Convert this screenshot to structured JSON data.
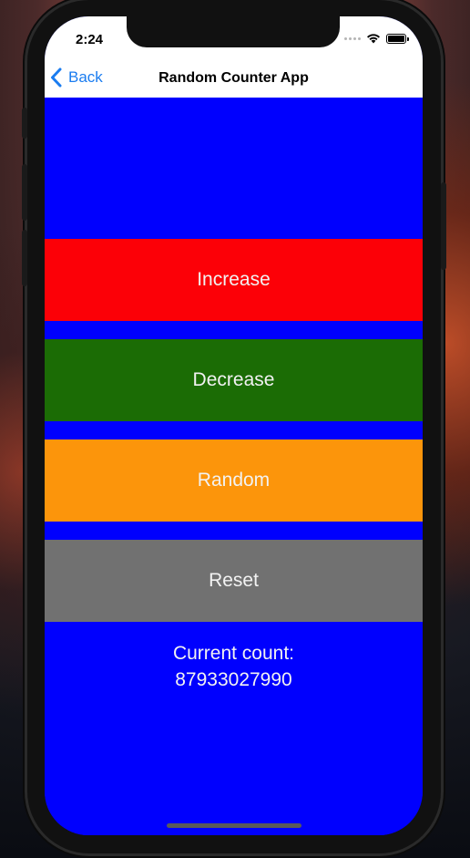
{
  "status_bar": {
    "time": "2:24"
  },
  "nav": {
    "back_label": "Back",
    "title": "Random Counter App",
    "accent_color": "#1a7cf0"
  },
  "buttons": {
    "increase": {
      "label": "Increase",
      "color": "#fc0007"
    },
    "decrease": {
      "label": "Decrease",
      "color": "#1b6c05"
    },
    "random": {
      "label": "Random",
      "color": "#fc950b"
    },
    "reset": {
      "label": "Reset",
      "color": "#717171"
    }
  },
  "counter": {
    "label": "Current count:",
    "value": "87933027990"
  },
  "background_color": "#0000fe",
  "icons": [
    "chevron-left-icon",
    "wifi-icon",
    "battery-icon",
    "signal-dots-icon"
  ]
}
